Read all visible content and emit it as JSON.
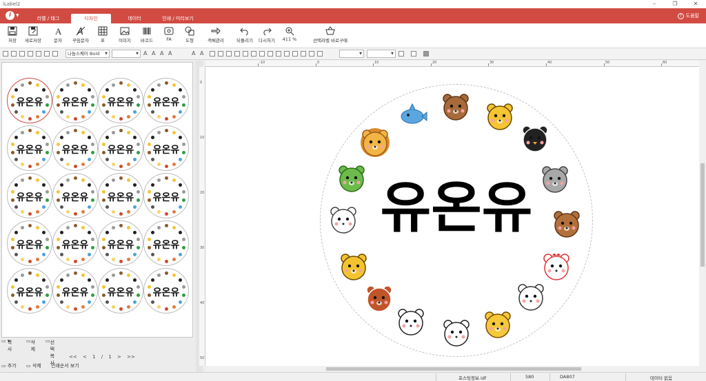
{
  "window": {
    "title": "iLabel2",
    "controls": [
      "–",
      "❐",
      "✕"
    ]
  },
  "ribbon": {
    "logo": "i",
    "tabs": [
      {
        "label": "라벨 / 태그",
        "active": false
      },
      {
        "label": "디자인",
        "active": true
      },
      {
        "label": "데이터",
        "active": false
      },
      {
        "label": "인쇄 / 미리보기",
        "active": false
      }
    ],
    "help": "도움말",
    "accent": "#d14b43"
  },
  "toolbar": {
    "items": [
      {
        "label": "저장",
        "icon": "save-icon"
      },
      {
        "label": "새로저장",
        "icon": "save-as-icon"
      },
      {
        "label": "문자",
        "icon": "text-icon"
      },
      {
        "label": "꾸밈문자",
        "icon": "fancy-text-icon"
      },
      {
        "label": "표",
        "icon": "table-icon"
      },
      {
        "label": "이미지",
        "icon": "image-icon"
      },
      {
        "label": "바코드",
        "icon": "barcode-icon"
      },
      {
        "label": "FA",
        "icon": "fa-icon"
      },
      {
        "label": "도형",
        "icon": "shape-icon"
      },
      {
        "label": "객체관리",
        "icon": "object-manage-icon"
      },
      {
        "label": "되돌리기",
        "icon": "undo-icon"
      },
      {
        "label": "다시하기",
        "icon": "redo-icon"
      },
      {
        "label": "411 %",
        "icon": "zoom-icon"
      },
      {
        "label": "선택라벨 바로구매",
        "icon": "basket-icon"
      }
    ]
  },
  "formatbar": {
    "font": "나눔스퀘어 Bold"
  },
  "leftpanel": {
    "label_text": "유온유",
    "actions": {
      "copy": "복사",
      "delete": "삭제",
      "select_copy": "선택복사"
    },
    "pager": {
      "first": "<<",
      "prev": "<",
      "page": "1 / 1",
      "next": ">",
      "last": ">>"
    },
    "bottom": {
      "add": "추가",
      "delete": "삭제",
      "order": "인쇄순서 보기"
    }
  },
  "ruler": {
    "h_ticks": [
      "-10",
      "0",
      "10",
      "20",
      "30",
      "40",
      "50",
      "60"
    ],
    "v_ticks": [
      "0",
      "10",
      "20",
      "30",
      "40",
      "50"
    ]
  },
  "canvas": {
    "label_text": "유온유"
  },
  "statusbar": {
    "file": "포스팅정보.idf",
    "count": "580",
    "code": "DA807",
    "data_status": "데이터 없음"
  }
}
